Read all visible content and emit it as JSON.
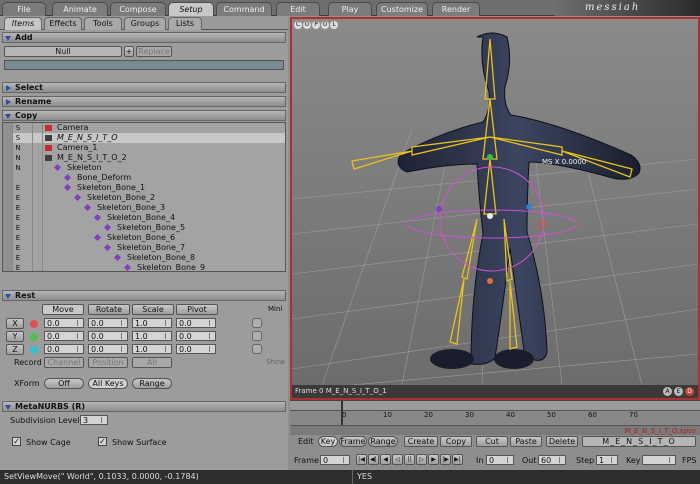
{
  "menu_tabs": [
    "File",
    "Animate",
    "Compose",
    "Setup",
    "Command",
    "Edit",
    "Play",
    "Customize",
    "Render"
  ],
  "logo": "messiah",
  "sub_tabs": [
    "Items",
    "Effects",
    "Tools",
    "Groups",
    "Lists"
  ],
  "add": {
    "title": "Add",
    "item": "Null",
    "replace": "Replace"
  },
  "sections": {
    "select": "Select",
    "rename": "Rename",
    "copy": "Copy",
    "rest": "Rest",
    "metanurbs": "MetaNURBS (R)"
  },
  "tree": [
    {
      "flag": "S",
      "name": "Camera",
      "indent": 0,
      "icon": "camera"
    },
    {
      "flag": "S",
      "name": "M_E_N_S_I_T_O",
      "indent": 0,
      "icon": "object",
      "selected": true
    },
    {
      "flag": "N",
      "name": "Camera_1",
      "indent": 0,
      "icon": "camera"
    },
    {
      "flag": "N",
      "name": "M_E_N_S_I_T_O_2",
      "indent": 0,
      "icon": "object"
    },
    {
      "flag": "N",
      "name": "Skeleton",
      "indent": 1,
      "icon": "bone"
    },
    {
      "flag": "",
      "name": "Bone_Deform",
      "indent": 2,
      "icon": "bone"
    },
    {
      "flag": "E",
      "name": "Skeleton_Bone_1",
      "indent": 2,
      "icon": "bone"
    },
    {
      "flag": "E",
      "name": "Skeleton_Bone_2",
      "indent": 3,
      "icon": "bone"
    },
    {
      "flag": "E",
      "name": "Skeleton_Bone_3",
      "indent": 4,
      "icon": "bone"
    },
    {
      "flag": "E",
      "name": "Skeleton_Bone_4",
      "indent": 5,
      "icon": "bone"
    },
    {
      "flag": "E",
      "name": "Skeleton_Bone_5",
      "indent": 6,
      "icon": "bone"
    },
    {
      "flag": "E",
      "name": "Skeleton_Bone_6",
      "indent": 5,
      "icon": "bone"
    },
    {
      "flag": "E",
      "name": "Skeleton_Bone_7",
      "indent": 6,
      "icon": "bone"
    },
    {
      "flag": "E",
      "name": "Skeleton_Bone_8",
      "indent": 7,
      "icon": "bone"
    },
    {
      "flag": "E",
      "name": "Skeleton_Bone_9",
      "indent": 8,
      "icon": "bone"
    }
  ],
  "rest": {
    "tabs": [
      "Move",
      "Rotate",
      "Scale",
      "Pivot"
    ],
    "min_label": "Mini",
    "axes": [
      "X",
      "Y",
      "Z"
    ],
    "values": [
      [
        "0.0",
        "0.0",
        "1.0",
        "0.0"
      ],
      [
        "0.0",
        "0.0",
        "1.0",
        "0.0"
      ],
      [
        "0.0",
        "0.0",
        "1.0",
        "0.0"
      ]
    ],
    "record_label": "Record",
    "record_btns": [
      "Channel",
      "Position",
      "All"
    ],
    "xform_label": "XForm",
    "xform_btns": [
      "Off",
      "All Keys",
      "Range"
    ],
    "show_label": "Show"
  },
  "metanurbs": {
    "subdiv_label": "Subdivision Level",
    "subdiv_value": "3",
    "show_cage": "Show Cage",
    "show_surface": "Show Surface"
  },
  "viewport": {
    "corner_btns": [
      "C",
      "O",
      "P",
      "O",
      "L"
    ],
    "label": "MS X 0.0000",
    "status": "Frame 0   M_E_N_S_I_T_O_1",
    "bottom_btns": [
      "A",
      "E",
      "D"
    ]
  },
  "timeline": {
    "ticks": [
      "0",
      "10",
      "20",
      "30",
      "40",
      "50",
      "60",
      "70"
    ],
    "track_label": "M_E_N_S_I_T_O.xpos"
  },
  "edit_bar": {
    "edit": "Edit",
    "key": "Key",
    "frame": "Frame",
    "range": "Range",
    "create": "Create",
    "copy": "Copy",
    "cut": "Cut",
    "paste": "Paste",
    "delete": "Delete",
    "object": "M_E_N_S_I_T_O"
  },
  "frame_bar": {
    "frame_label": "Frame",
    "frame": "0",
    "in_label": "In",
    "in": "0",
    "out_label": "Out",
    "out": "60",
    "step_label": "Step",
    "step": "1",
    "key_label": "Key",
    "fps": "FPS"
  },
  "status": {
    "command": "SetViewMove(\" World\", 0.1033, 0.0000, -0.1784)",
    "answer": "YES"
  }
}
